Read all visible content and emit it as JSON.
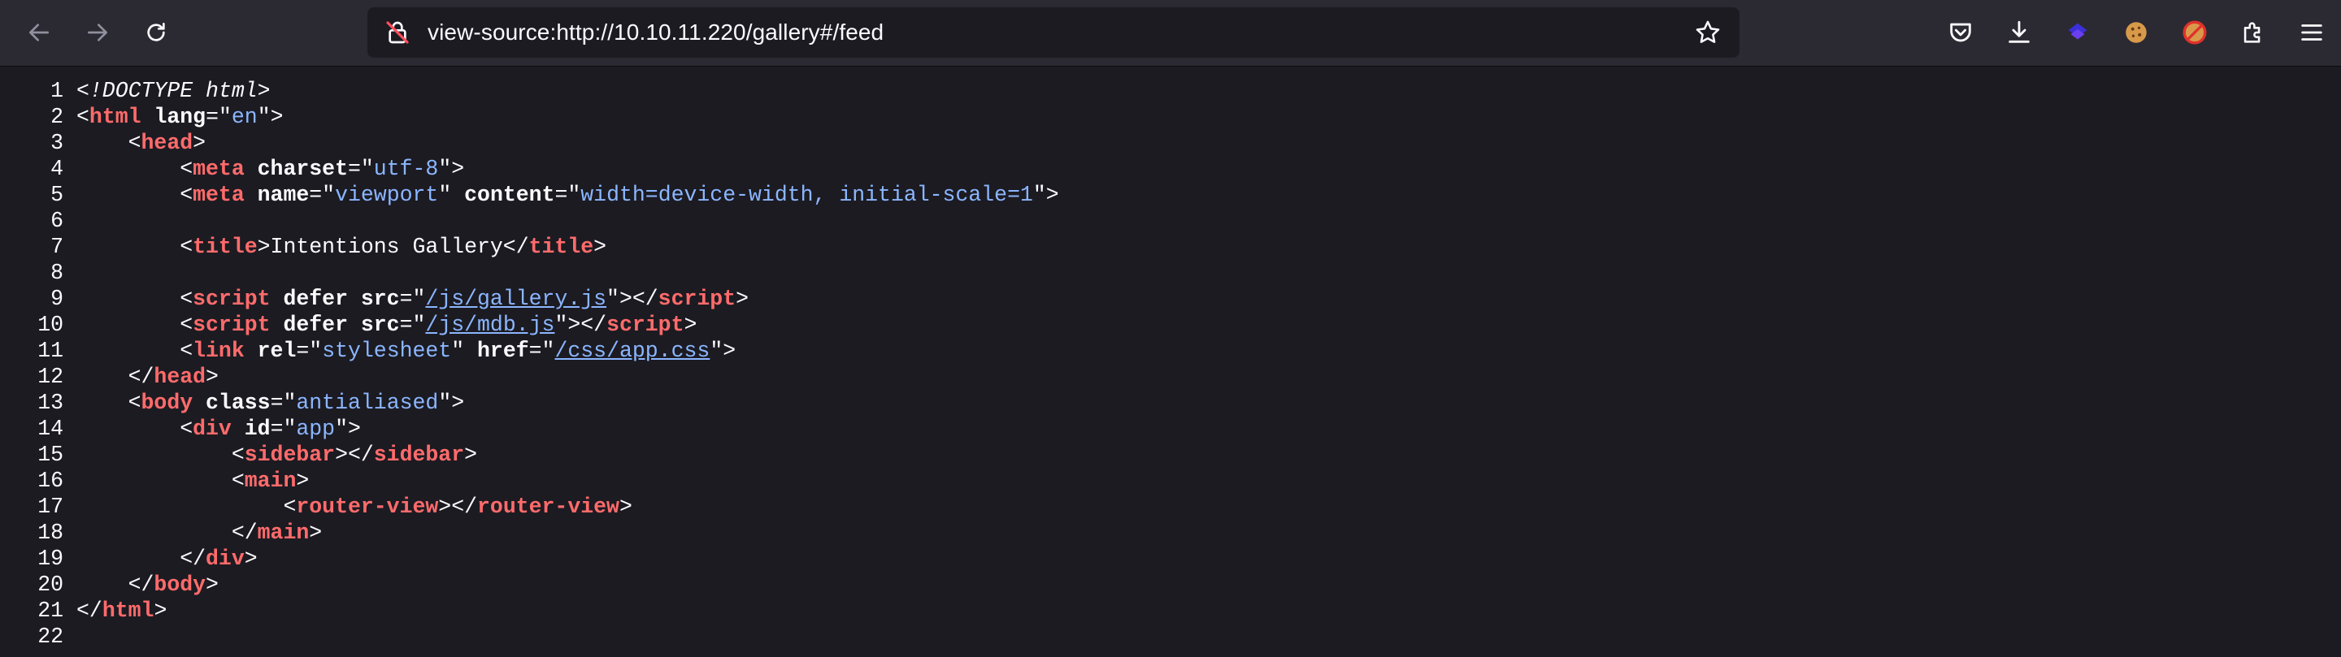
{
  "browser": {
    "url": "view-source:http://10.10.11.220/gallery#/feed",
    "icons": [
      "back-arrow-icon",
      "forward-arrow-icon",
      "reload-icon",
      "connection-not-secure-icon",
      "bookmark-star-icon",
      "pocket-icon",
      "downloads-icon",
      "extension-purple-icon",
      "cookie-extension-icon",
      "blocked-extension-icon",
      "extensions-puzzle-icon",
      "menu-hamburger-icon"
    ]
  },
  "source": {
    "line_numbers": [
      "1",
      "2",
      "3",
      "4",
      "5",
      "6",
      "7",
      "8",
      "9",
      "10",
      "11",
      "12",
      "13",
      "14",
      "15",
      "16",
      "17",
      "18",
      "19",
      "20",
      "21",
      "22"
    ],
    "lines": [
      [
        {
          "t": "doctype",
          "v": "<!DOCTYPE html>"
        }
      ],
      [
        {
          "t": "plain",
          "v": "<"
        },
        {
          "t": "tag",
          "v": "html"
        },
        {
          "t": "plain",
          "v": " "
        },
        {
          "t": "attr",
          "v": "lang"
        },
        {
          "t": "plain",
          "v": "=\""
        },
        {
          "t": "val",
          "v": "en"
        },
        {
          "t": "plain",
          "v": "\">"
        }
      ],
      [
        {
          "t": "plain",
          "v": "    <"
        },
        {
          "t": "tag",
          "v": "head"
        },
        {
          "t": "plain",
          "v": ">"
        }
      ],
      [
        {
          "t": "plain",
          "v": "        <"
        },
        {
          "t": "tag",
          "v": "meta"
        },
        {
          "t": "plain",
          "v": " "
        },
        {
          "t": "attr",
          "v": "charset"
        },
        {
          "t": "plain",
          "v": "=\""
        },
        {
          "t": "val",
          "v": "utf-8"
        },
        {
          "t": "plain",
          "v": "\">"
        }
      ],
      [
        {
          "t": "plain",
          "v": "        <"
        },
        {
          "t": "tag",
          "v": "meta"
        },
        {
          "t": "plain",
          "v": " "
        },
        {
          "t": "attr",
          "v": "name"
        },
        {
          "t": "plain",
          "v": "=\""
        },
        {
          "t": "val",
          "v": "viewport"
        },
        {
          "t": "plain",
          "v": "\" "
        },
        {
          "t": "attr",
          "v": "content"
        },
        {
          "t": "plain",
          "v": "=\""
        },
        {
          "t": "val",
          "v": "width=device-width, initial-scale=1"
        },
        {
          "t": "plain",
          "v": "\">"
        }
      ],
      [],
      [
        {
          "t": "plain",
          "v": "        <"
        },
        {
          "t": "tag",
          "v": "title"
        },
        {
          "t": "plain",
          "v": ">Intentions Gallery</"
        },
        {
          "t": "tag",
          "v": "title"
        },
        {
          "t": "plain",
          "v": ">"
        }
      ],
      [],
      [
        {
          "t": "plain",
          "v": "        <"
        },
        {
          "t": "tag",
          "v": "script"
        },
        {
          "t": "plain",
          "v": " "
        },
        {
          "t": "attr",
          "v": "defer"
        },
        {
          "t": "plain",
          "v": " "
        },
        {
          "t": "attr",
          "v": "src"
        },
        {
          "t": "plain",
          "v": "=\""
        },
        {
          "t": "link",
          "v": "/js/gallery.js"
        },
        {
          "t": "plain",
          "v": "\"></"
        },
        {
          "t": "tag",
          "v": "script"
        },
        {
          "t": "plain",
          "v": ">"
        }
      ],
      [
        {
          "t": "plain",
          "v": "        <"
        },
        {
          "t": "tag",
          "v": "script"
        },
        {
          "t": "plain",
          "v": " "
        },
        {
          "t": "attr",
          "v": "defer"
        },
        {
          "t": "plain",
          "v": " "
        },
        {
          "t": "attr",
          "v": "src"
        },
        {
          "t": "plain",
          "v": "=\""
        },
        {
          "t": "link",
          "v": "/js/mdb.js"
        },
        {
          "t": "plain",
          "v": "\"></"
        },
        {
          "t": "tag",
          "v": "script"
        },
        {
          "t": "plain",
          "v": ">"
        }
      ],
      [
        {
          "t": "plain",
          "v": "        <"
        },
        {
          "t": "tag",
          "v": "link"
        },
        {
          "t": "plain",
          "v": " "
        },
        {
          "t": "attr",
          "v": "rel"
        },
        {
          "t": "plain",
          "v": "=\""
        },
        {
          "t": "val",
          "v": "stylesheet"
        },
        {
          "t": "plain",
          "v": "\" "
        },
        {
          "t": "attr",
          "v": "href"
        },
        {
          "t": "plain",
          "v": "=\""
        },
        {
          "t": "link",
          "v": "/css/app.css"
        },
        {
          "t": "plain",
          "v": "\">"
        }
      ],
      [
        {
          "t": "plain",
          "v": "    </"
        },
        {
          "t": "tag",
          "v": "head"
        },
        {
          "t": "plain",
          "v": ">"
        }
      ],
      [
        {
          "t": "plain",
          "v": "    <"
        },
        {
          "t": "tag",
          "v": "body"
        },
        {
          "t": "plain",
          "v": " "
        },
        {
          "t": "attr",
          "v": "class"
        },
        {
          "t": "plain",
          "v": "=\""
        },
        {
          "t": "val",
          "v": "antialiased"
        },
        {
          "t": "plain",
          "v": "\">"
        }
      ],
      [
        {
          "t": "plain",
          "v": "        <"
        },
        {
          "t": "tag",
          "v": "div"
        },
        {
          "t": "plain",
          "v": " "
        },
        {
          "t": "attr",
          "v": "id"
        },
        {
          "t": "plain",
          "v": "=\""
        },
        {
          "t": "val",
          "v": "app"
        },
        {
          "t": "plain",
          "v": "\">"
        }
      ],
      [
        {
          "t": "plain",
          "v": "            <"
        },
        {
          "t": "tag",
          "v": "sidebar"
        },
        {
          "t": "plain",
          "v": "></"
        },
        {
          "t": "tag",
          "v": "sidebar"
        },
        {
          "t": "plain",
          "v": ">"
        }
      ],
      [
        {
          "t": "plain",
          "v": "            <"
        },
        {
          "t": "tag",
          "v": "main"
        },
        {
          "t": "plain",
          "v": ">"
        }
      ],
      [
        {
          "t": "plain",
          "v": "                <"
        },
        {
          "t": "tag",
          "v": "router-view"
        },
        {
          "t": "plain",
          "v": "></"
        },
        {
          "t": "tag",
          "v": "router-view"
        },
        {
          "t": "plain",
          "v": ">"
        }
      ],
      [
        {
          "t": "plain",
          "v": "            </"
        },
        {
          "t": "tag",
          "v": "main"
        },
        {
          "t": "plain",
          "v": ">"
        }
      ],
      [
        {
          "t": "plain",
          "v": "        </"
        },
        {
          "t": "tag",
          "v": "div"
        },
        {
          "t": "plain",
          "v": ">"
        }
      ],
      [
        {
          "t": "plain",
          "v": "    </"
        },
        {
          "t": "tag",
          "v": "body"
        },
        {
          "t": "plain",
          "v": ">"
        }
      ],
      [
        {
          "t": "plain",
          "v": "</"
        },
        {
          "t": "tag",
          "v": "html"
        },
        {
          "t": "plain",
          "v": ">"
        }
      ],
      []
    ]
  }
}
